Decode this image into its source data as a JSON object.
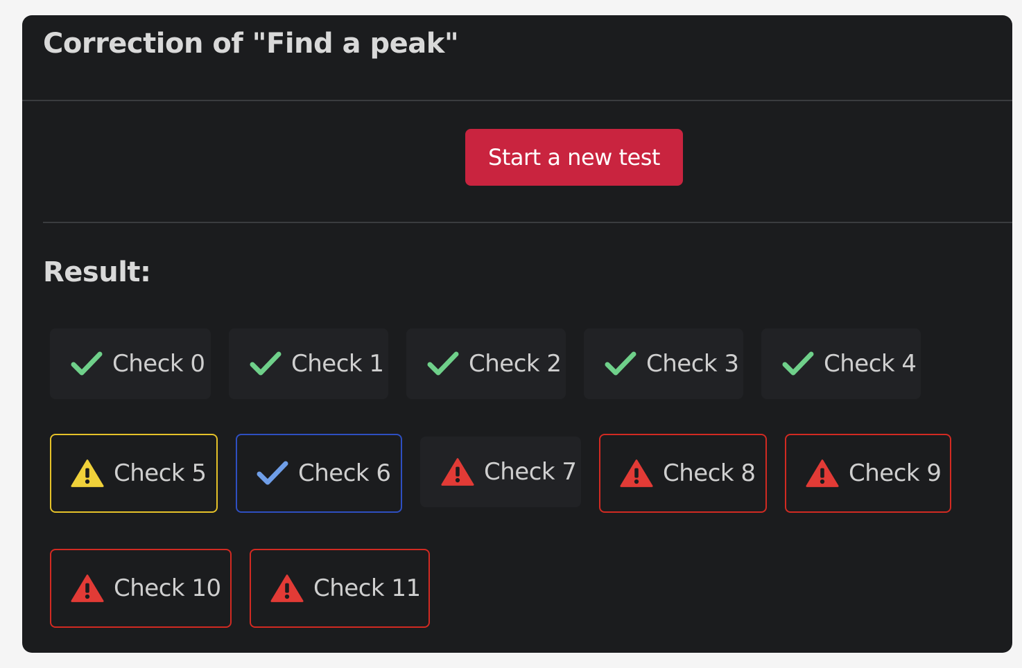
{
  "header": {
    "title": "Correction of \"Find a peak\""
  },
  "actions": {
    "start_label": "Start a new test"
  },
  "result": {
    "title": "Result:"
  },
  "colors": {
    "pass": "#6fd08a",
    "warn": "#f0d13a",
    "info": "#6f9ee8",
    "error": "#e23b36",
    "button": "#c9243f"
  },
  "checks": [
    {
      "label": "Check 0",
      "status": "pass",
      "icon": "checkmark-icon"
    },
    {
      "label": "Check 1",
      "status": "pass",
      "icon": "checkmark-icon"
    },
    {
      "label": "Check 2",
      "status": "pass",
      "icon": "checkmark-icon"
    },
    {
      "label": "Check 3",
      "status": "pass",
      "icon": "checkmark-icon"
    },
    {
      "label": "Check 4",
      "status": "pass",
      "icon": "checkmark-icon"
    },
    {
      "label": "Check 5",
      "status": "warning",
      "icon": "warning-icon"
    },
    {
      "label": "Check 6",
      "status": "info",
      "icon": "checkmark-icon"
    },
    {
      "label": "Check 7",
      "status": "error",
      "icon": "warning-icon"
    },
    {
      "label": "Check 8",
      "status": "error",
      "icon": "warning-icon"
    },
    {
      "label": "Check 9",
      "status": "error",
      "icon": "warning-icon"
    },
    {
      "label": "Check 10",
      "status": "error",
      "icon": "warning-icon"
    },
    {
      "label": "Check 11",
      "status": "error",
      "icon": "warning-icon"
    }
  ]
}
